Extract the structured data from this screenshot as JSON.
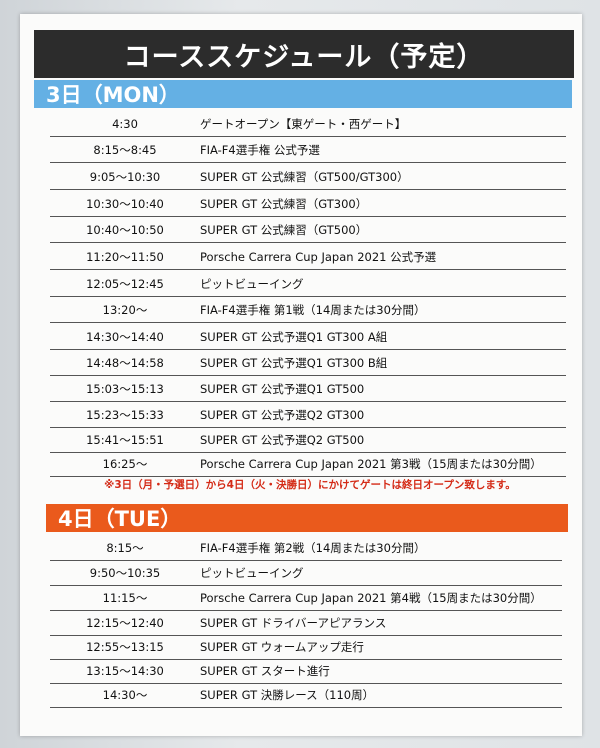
{
  "title": "コーススケジュール（予定）",
  "day1": {
    "label": "3日（MON）",
    "rows": [
      {
        "time": "4:30",
        "event": "ゲートオープン【東ゲート・西ゲート】"
      },
      {
        "time": "8:15〜8:45",
        "event": "FIA-F4選手権 公式予選"
      },
      {
        "time": "9:05〜10:30",
        "event": "SUPER GT 公式練習（GT500/GT300）"
      },
      {
        "time": "10:30〜10:40",
        "event": "SUPER GT 公式練習（GT300）"
      },
      {
        "time": "10:40〜10:50",
        "event": "SUPER GT 公式練習（GT500）"
      },
      {
        "time": "11:20〜11:50",
        "event": "Porsche Carrera Cup Japan 2021 公式予選"
      },
      {
        "time": "12:05〜12:45",
        "event": "ピットビューイング"
      },
      {
        "time": "13:20〜",
        "event": "FIA-F4選手権 第1戦（14周または30分間）"
      },
      {
        "time": "14:30〜14:40",
        "event": "SUPER GT 公式予選Q1 GT300 A組"
      },
      {
        "time": "14:48〜14:58",
        "event": "SUPER GT 公式予選Q1 GT300 B組"
      },
      {
        "time": "15:03〜15:13",
        "event": "SUPER GT 公式予選Q1 GT500"
      },
      {
        "time": "15:23〜15:33",
        "event": "SUPER GT 公式予選Q2 GT300"
      },
      {
        "time": "15:41〜15:51",
        "event": "SUPER GT 公式予選Q2 GT500"
      },
      {
        "time": "16:25〜",
        "event": "Porsche Carrera Cup Japan 2021 第3戦（15周または30分間）"
      }
    ]
  },
  "notice": "※3日（月・予選日）から4日（火・決勝日）にかけてゲートは終日オープン致します。",
  "day2": {
    "label": "4日（TUE）",
    "rows": [
      {
        "time": "8:15〜",
        "event": "FIA-F4選手権 第2戦（14周または30分間）"
      },
      {
        "time": "9:50〜10:35",
        "event": "ピットビューイング"
      },
      {
        "time": "11:15〜",
        "event": "Porsche Carrera Cup Japan 2021 第4戦（15周または30分間）"
      },
      {
        "time": "12:15〜12:40",
        "event": "SUPER GT ドライバーアピアランス"
      },
      {
        "time": "12:55〜13:15",
        "event": "SUPER GT ウォームアップ走行"
      },
      {
        "time": "13:15〜14:30",
        "event": "SUPER GT スタート進行"
      },
      {
        "time": "14:30〜",
        "event": "SUPER GT 決勝レース（110周）"
      }
    ]
  }
}
